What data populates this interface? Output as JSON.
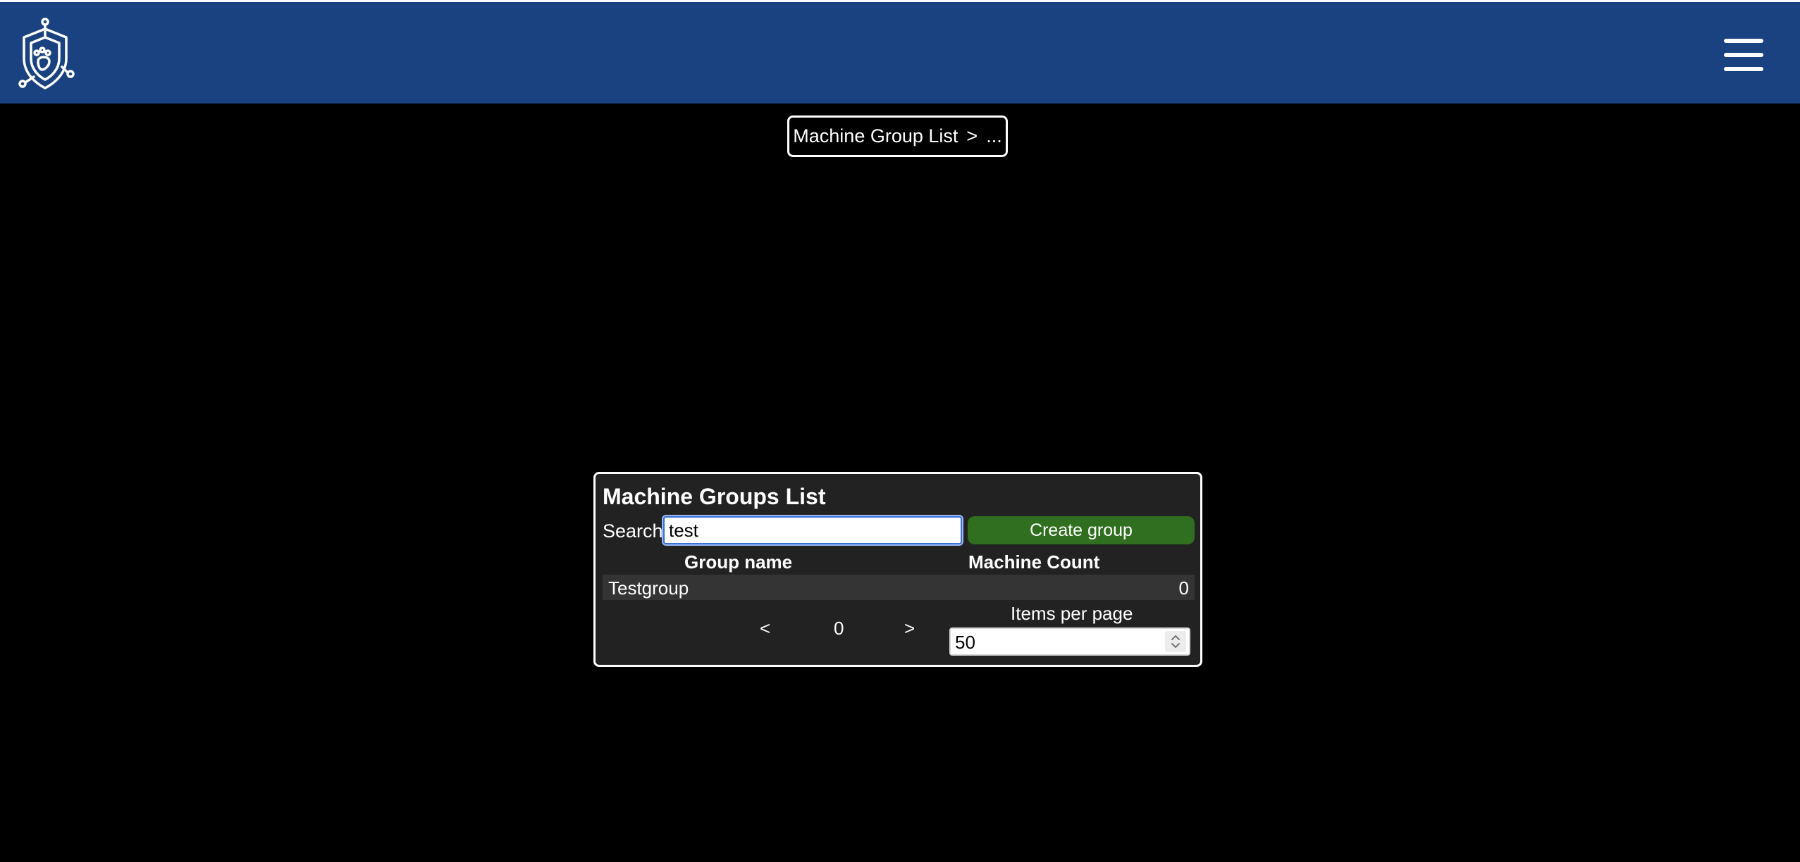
{
  "header": {
    "logo_icon": "shield-circuit-logo-icon",
    "menu_icon": "hamburger-menu-icon",
    "bar_color": "#1b4280"
  },
  "breadcrumb": {
    "item": "Machine Group List",
    "separator": ">",
    "current": "..."
  },
  "panel": {
    "title": "Machine Groups List",
    "search_label": "Search",
    "search_value": "test",
    "create_button": "Create group",
    "create_button_color": "#2f6f1f",
    "columns": [
      "Group name",
      "Machine Count"
    ],
    "rows": [
      {
        "name": "Testgroup",
        "count": "0"
      }
    ],
    "pager": {
      "prev": "<",
      "page": "0",
      "next": ">"
    },
    "items_per_page_label": "Items per page",
    "items_per_page_value": "50"
  }
}
